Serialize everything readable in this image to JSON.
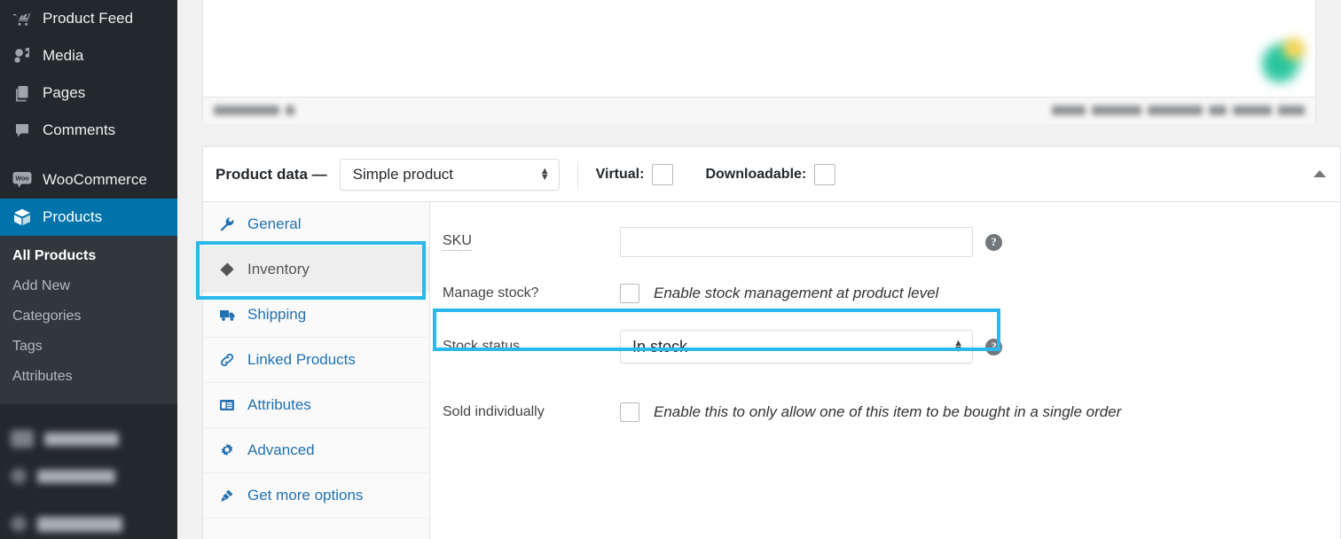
{
  "sidebar": {
    "items": [
      {
        "label": "Product Feed",
        "icon": "product-feed-icon"
      },
      {
        "label": "Media",
        "icon": "media-icon"
      },
      {
        "label": "Pages",
        "icon": "pages-icon"
      },
      {
        "label": "Comments",
        "icon": "comments-icon"
      },
      {
        "label": "WooCommerce",
        "icon": "woocommerce-icon"
      },
      {
        "label": "Products",
        "icon": "products-icon",
        "current": true
      }
    ],
    "submenu": [
      {
        "label": "All Products",
        "active": true
      },
      {
        "label": "Add New",
        "active": false
      },
      {
        "label": "Categories",
        "active": false
      },
      {
        "label": "Tags",
        "active": false
      },
      {
        "label": "Attributes",
        "active": false
      }
    ]
  },
  "product_data": {
    "title": "Product data —",
    "type_value": "Simple product",
    "virtual_label": "Virtual:",
    "downloadable_label": "Downloadable:",
    "collapse_icon": "chevron-up-icon",
    "tabs": [
      {
        "label": "General",
        "icon": "wrench-icon",
        "active": false
      },
      {
        "label": "Inventory",
        "icon": "tag-icon",
        "active": true
      },
      {
        "label": "Shipping",
        "icon": "truck-icon",
        "active": false
      },
      {
        "label": "Linked Products",
        "icon": "link-icon",
        "active": false
      },
      {
        "label": "Attributes",
        "icon": "list-icon",
        "active": false
      },
      {
        "label": "Advanced",
        "icon": "gear-icon",
        "active": false
      },
      {
        "label": "Get more options",
        "icon": "plug-icon",
        "active": false
      }
    ],
    "fields": {
      "sku_label": "SKU",
      "sku_value": "",
      "manage_stock_label": "Manage stock?",
      "manage_stock_desc": "Enable stock management at product level",
      "stock_status_label": "Stock status",
      "stock_status_value": "In stock",
      "sold_individually_label": "Sold individually",
      "sold_individually_desc": "Enable this to only allow one of this item to be bought in a single order"
    },
    "help_icon": "help-icon"
  },
  "colors": {
    "highlight": "#2bb8ec",
    "sidebar_bg": "#23282d",
    "current_nav": "#0073aa",
    "link": "#2271b1"
  }
}
